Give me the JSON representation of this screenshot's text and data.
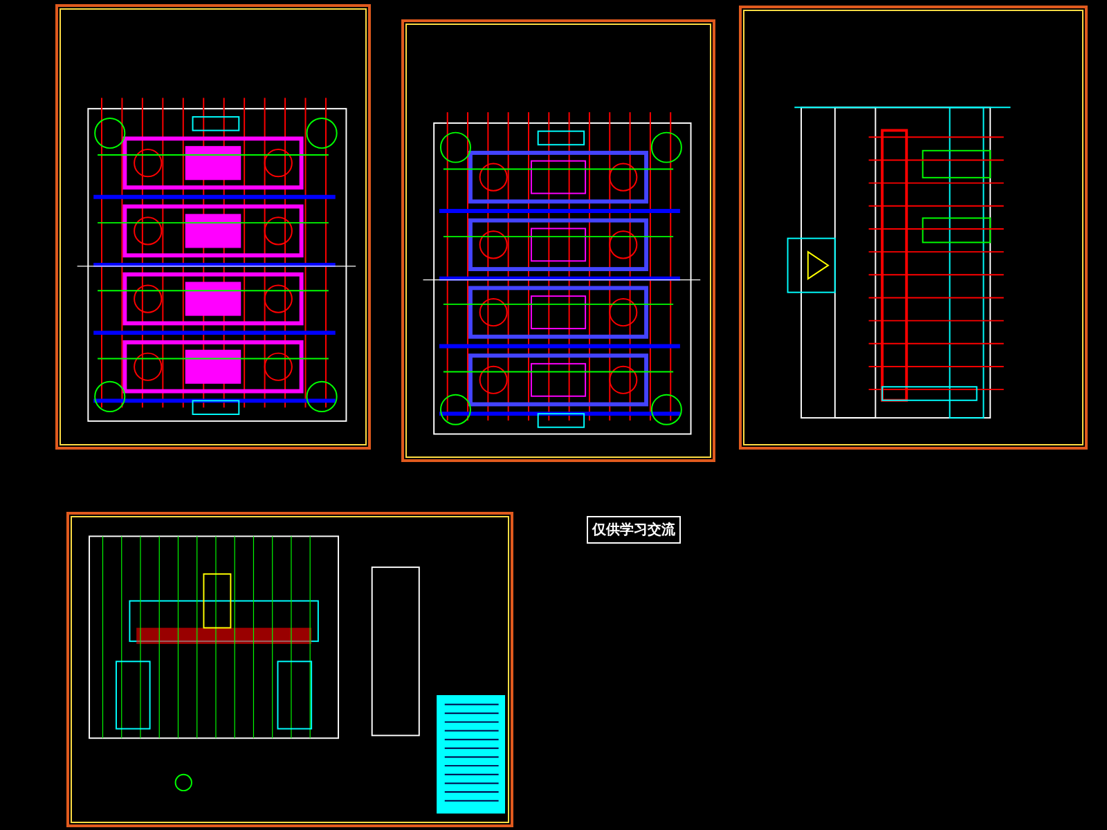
{
  "sheets": [
    {
      "kind": "plan"
    },
    {
      "kind": "plan-alt"
    },
    {
      "kind": "section"
    },
    {
      "kind": "assembly"
    }
  ],
  "note": {
    "text": "仅供学习交流"
  }
}
